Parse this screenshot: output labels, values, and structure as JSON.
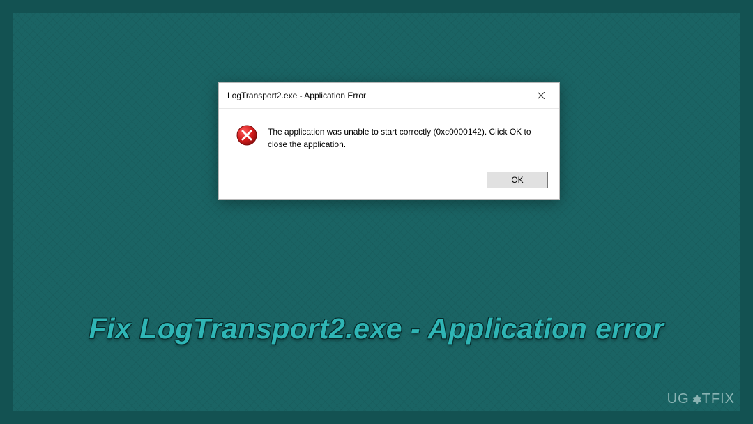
{
  "dialog": {
    "title": "LogTransport2.exe - Application Error",
    "message": "The application was unable to start correctly (0xc0000142). Click OK to close the application.",
    "ok_label": "OK"
  },
  "headline": "Fix LogTransport2.exe - Application error",
  "watermark": {
    "prefix": "UG",
    "suffix": "TFIX"
  }
}
